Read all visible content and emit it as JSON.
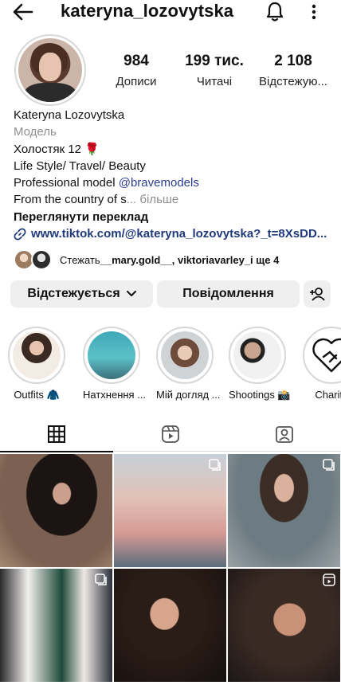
{
  "header": {
    "username": "kateryna_lozovytska",
    "back_icon": "back-arrow-icon",
    "bell_icon": "bell-icon",
    "more_icon": "more-vertical-icon"
  },
  "stats": [
    {
      "value": "984",
      "label": "Дописи"
    },
    {
      "value": "199 тис.",
      "label": "Читачі"
    },
    {
      "value": "2 108",
      "label": "Відстежую..."
    }
  ],
  "bio": {
    "name": "Kateryna Lozovytska",
    "category": "Модель",
    "line1_text": "Холостяк 12",
    "line1_emoji": "🌹",
    "line2": "Life Style/ Travel/ Beauty",
    "line3_prefix": "Professional model ",
    "line3_handle": "@bravemodels",
    "line4_text": "From the country of s",
    "line4_more": "... більше",
    "translate": "Переглянути переклад",
    "url": "www.tiktok.com/@kateryna_lozovytska?_t=8XsDD..."
  },
  "followed_by": {
    "prefix": "Стежать ",
    "names": "__mary.gold__, viktoriavarley_",
    "suffix": " і ще 4"
  },
  "buttons": {
    "follow": "Відстежується",
    "message": "Повідомлення"
  },
  "highlights": [
    {
      "label": "Outfits 🧥"
    },
    {
      "label": "Натхнення ..."
    },
    {
      "label": "Мій догляд ..."
    },
    {
      "label": "Shootings 📸"
    },
    {
      "label": "Charity"
    }
  ],
  "colors": {
    "button_bg": "#efefef",
    "link": "#2b3d8f",
    "muted": "#8e8e8e"
  }
}
